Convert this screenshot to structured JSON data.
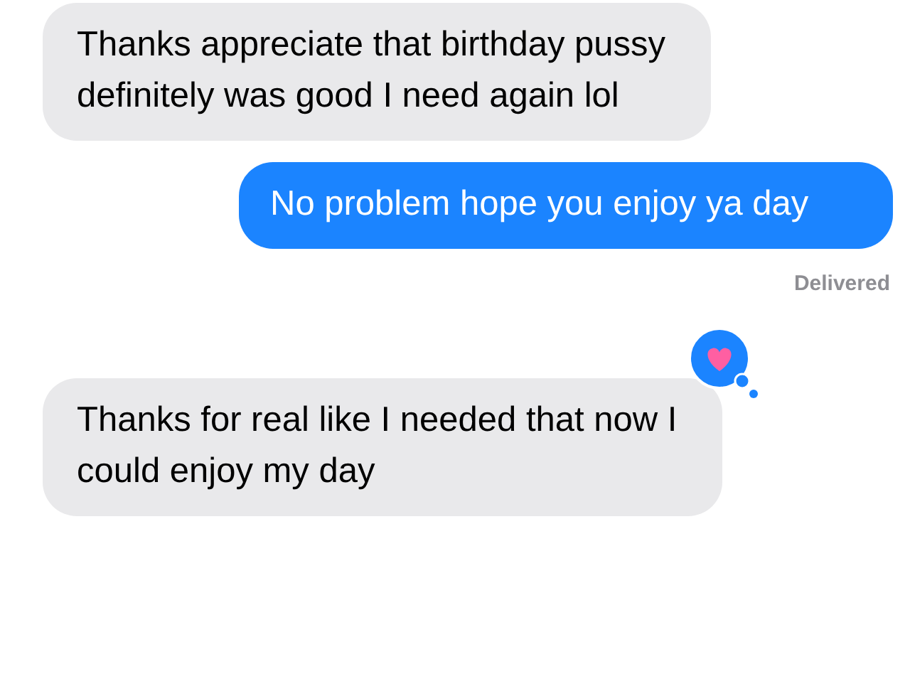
{
  "messages": [
    {
      "kind": "received",
      "text": "Thanks appreciate that birthday pussy definitely was good I need again lol",
      "reacted": false
    },
    {
      "kind": "sent",
      "text": "No problem hope you enjoy ya day",
      "reacted": false
    },
    {
      "kind": "status",
      "text": "Delivered"
    },
    {
      "kind": "received",
      "text": "Thanks for real like I needed that now I could enjoy my day",
      "reacted": true
    }
  ]
}
